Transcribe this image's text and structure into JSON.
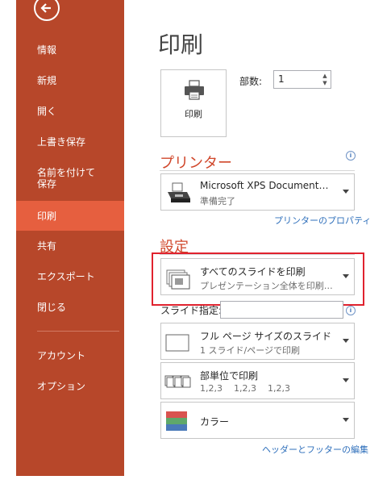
{
  "sidebar": {
    "items": [
      {
        "label": "情報"
      },
      {
        "label": "新規"
      },
      {
        "label": "開く"
      },
      {
        "label": "上書き保存"
      },
      {
        "label": "名前を付けて\n保存"
      },
      {
        "label": "印刷"
      },
      {
        "label": "共有"
      },
      {
        "label": "エクスポート"
      },
      {
        "label": "閉じる"
      },
      {
        "label": "アカウント"
      },
      {
        "label": "オプション"
      }
    ],
    "active": "印刷"
  },
  "page": {
    "title": "印刷"
  },
  "print_button": {
    "label": "印刷"
  },
  "copies": {
    "label": "部数:",
    "value": "1"
  },
  "printer": {
    "heading": "プリンター",
    "name": "Microsoft XPS Document…",
    "status": "準備完了",
    "properties_link": "プリンターのプロパティ"
  },
  "settings": {
    "heading": "設定",
    "range": {
      "title": "すべてのスライドを印刷",
      "subtitle": "プレゼンテーション全体を印刷…"
    },
    "slides_label": "スライド指定:",
    "slides_value": "",
    "layout": {
      "title": "フル ページ サイズのスライド",
      "subtitle": "1 スライド/ページで印刷"
    },
    "collate": {
      "title": "部単位で印刷",
      "subtitle": "1,2,3    1,2,3    1,2,3"
    },
    "color": {
      "title": "カラー"
    },
    "header_footer_link": "ヘッダーとフッターの編集"
  },
  "colors": {
    "sidebar": "#b7472a",
    "sidebar_active": "#e65f3f",
    "heading": "#d0472b",
    "link": "#2e6fbb",
    "highlight": "#e0222e"
  },
  "icons": {
    "back": "back-arrow-icon",
    "printer": "printer-icon",
    "info": "info-icon",
    "slides": "slides-stack-icon",
    "full_page": "full-page-slide-icon",
    "collate": "collate-icon",
    "color": "color-swatch-icon"
  }
}
